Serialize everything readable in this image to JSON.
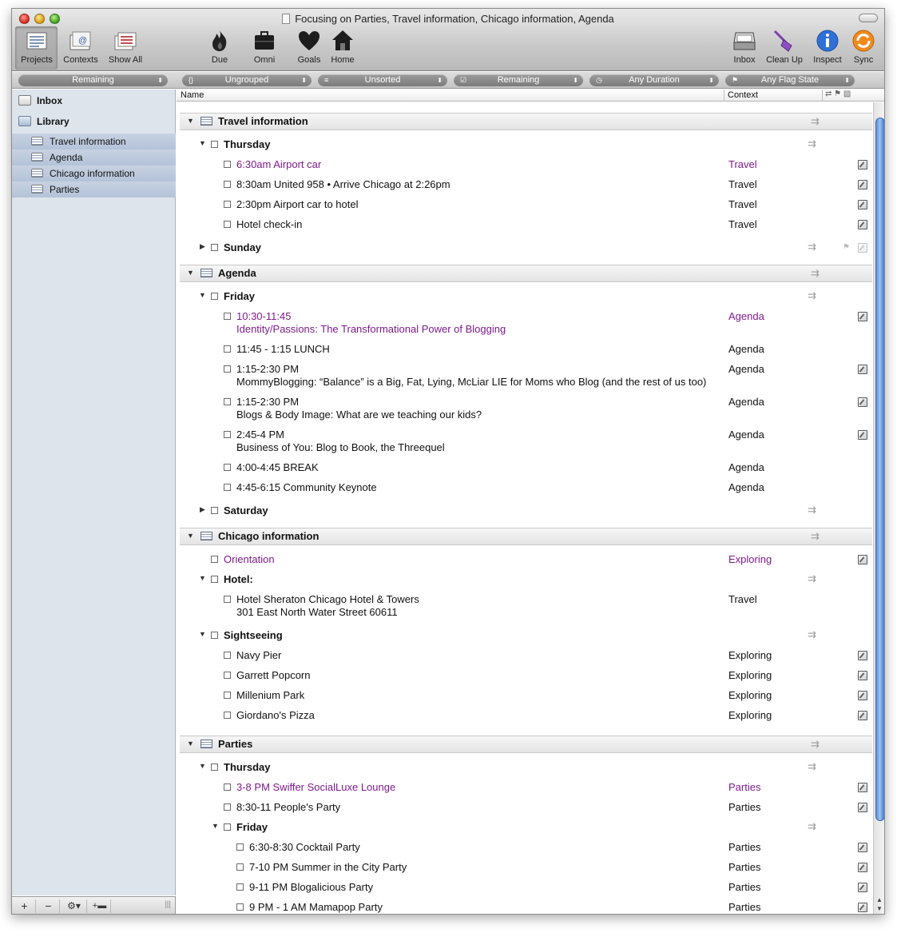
{
  "window": {
    "title": "Focusing on Parties, Travel information, Chicago information, Agenda"
  },
  "toolbar": {
    "left": [
      "Projects",
      "Contexts",
      "Show All"
    ],
    "center": [
      "Due",
      "Omni",
      "Goals",
      "Home"
    ],
    "right": [
      "Inbox",
      "Clean Up",
      "Inspect",
      "Sync"
    ]
  },
  "filters": {
    "sidebar": "Remaining",
    "grouping": "Ungrouped",
    "sorting": "Unsorted",
    "status": "Remaining",
    "duration": "Any Duration",
    "flag": "Any Flag State"
  },
  "sidebar": {
    "top": [
      "Inbox",
      "Library"
    ],
    "projects": [
      "Travel information",
      "Agenda",
      "Chicago information",
      "Parties"
    ]
  },
  "columns": {
    "name": "Name",
    "context": "Context"
  },
  "outline": {
    "travel": {
      "title": "Travel information",
      "thursday": "Thursday",
      "items": [
        {
          "title": "6:30am Airport car",
          "context": "Travel"
        },
        {
          "title": "8:30am United 958 • Arrive Chicago at 2:26pm",
          "context": "Travel"
        },
        {
          "title": "2:30pm Airport car to hotel",
          "context": "Travel"
        },
        {
          "title": "Hotel check-in",
          "context": "Travel"
        }
      ],
      "sunday": "Sunday"
    },
    "agenda": {
      "title": "Agenda",
      "friday": "Friday",
      "items": [
        {
          "line1": "10:30-11:45",
          "line2": "Identity/Passions: The Transformational Power of Blogging",
          "context": "Agenda"
        },
        {
          "line1": "11:45 - 1:15 LUNCH",
          "line2": "",
          "context": "Agenda"
        },
        {
          "line1": "1:15-2:30 PM",
          "line2": "MommyBlogging: “Balance” is a Big, Fat, Lying, McLiar LIE for Moms who Blog (and the rest of us too)",
          "context": "Agenda"
        },
        {
          "line1": "1:15-2:30 PM",
          "line2": "Blogs & Body Image: What are we teaching our kids?",
          "context": "Agenda"
        },
        {
          "line1": "2:45-4 PM",
          "line2": "Business of You: Blog to Book, the Threequel",
          "context": "Agenda"
        },
        {
          "line1": "4:00-4:45 BREAK",
          "line2": "",
          "context": "Agenda"
        },
        {
          "line1": "4:45-6:15 Community Keynote",
          "line2": "",
          "context": "Agenda"
        }
      ],
      "saturday": "Saturday"
    },
    "chicago": {
      "title": "Chicago information",
      "orientation": {
        "title": "Orientation",
        "context": "Exploring"
      },
      "hotel": "Hotel:",
      "hotel_item": {
        "line1": "Hotel Sheraton Chicago Hotel & Towers",
        "line2": "301 East North Water Street 60611",
        "context": "Travel"
      },
      "sightseeing": "Sightseeing",
      "sights": [
        {
          "title": "Navy Pier",
          "context": "Exploring"
        },
        {
          "title": "Garrett Popcorn",
          "context": "Exploring"
        },
        {
          "title": "Millenium Park",
          "context": "Exploring"
        },
        {
          "title": "Giordano's Pizza",
          "context": "Exploring"
        }
      ]
    },
    "parties": {
      "title": "Parties",
      "thursday": "Thursday",
      "thursday_items": [
        {
          "title": "3-8 PM Swiffer SocialLuxe Lounge",
          "context": "Parties"
        },
        {
          "title": "8:30-11 People's Party",
          "context": "Parties"
        }
      ],
      "friday": "Friday",
      "friday_items": [
        {
          "title": "6:30-8:30 Cocktail Party",
          "context": "Parties"
        },
        {
          "title": "7-10 PM Summer in the City Party",
          "context": "Parties"
        },
        {
          "title": "9-11 PM Blogalicious Party",
          "context": "Parties"
        },
        {
          "title": "9 PM - 1 AM Mamapop Party",
          "context": "Parties"
        }
      ]
    }
  },
  "colors": {
    "due_soon": "#7d1b8c",
    "selection": "#b4c3d8",
    "scroll_thumb": "#5b8fd8"
  }
}
